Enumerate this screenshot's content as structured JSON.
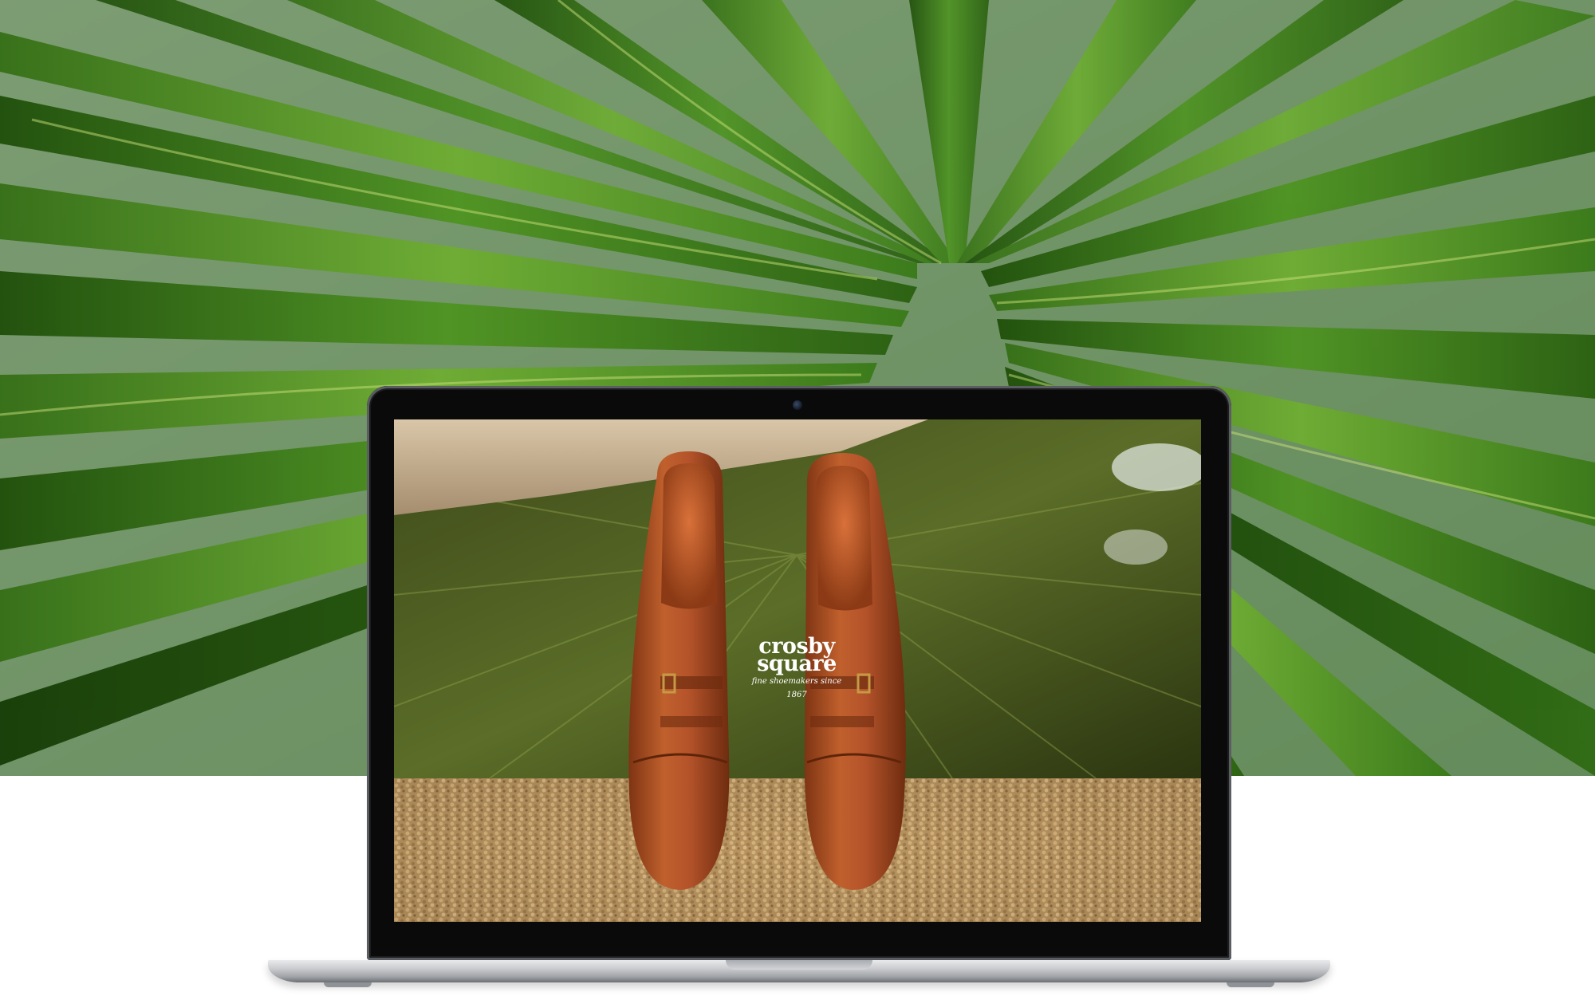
{
  "hero": {
    "backdrop": "palm-leaves-photo",
    "background_below": "#ffffff"
  },
  "laptop": {
    "screen": {
      "image": "monk-strap-shoes-photo",
      "brand_logo": {
        "line1": "crosby",
        "line2": "square",
        "tagline_line1": "fine shoemakers since",
        "tagline_line2": "1867"
      }
    }
  },
  "colors": {
    "leaf_green": "#3f7a1c",
    "shoe_tan": "#b4532a",
    "laptop_silver": "#c8cacd",
    "bezel": "#0a0a0a"
  }
}
